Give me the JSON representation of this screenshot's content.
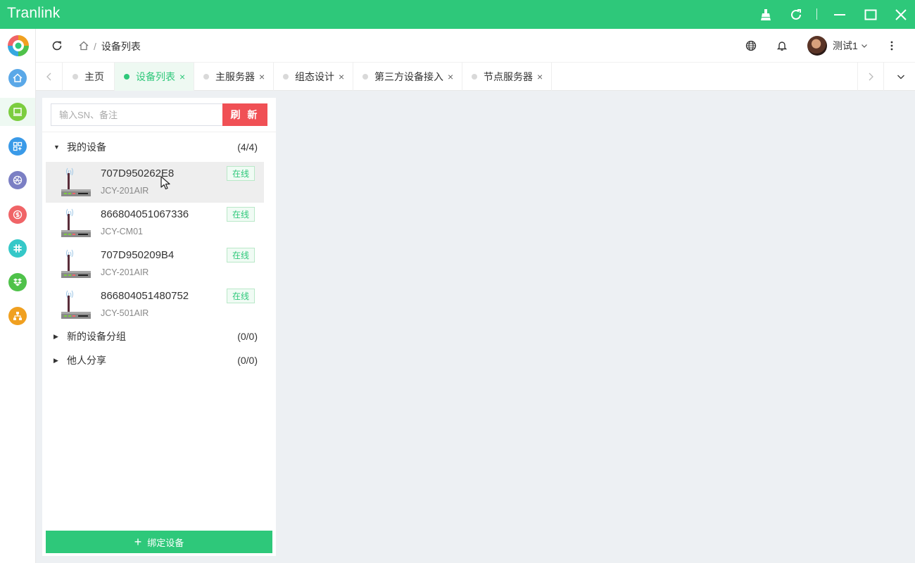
{
  "window": {
    "title": "Tranlink",
    "controls": [
      "broom-icon",
      "refresh-icon",
      "minimize-icon",
      "maximize-icon",
      "close-icon"
    ]
  },
  "colors": {
    "primary": "#2ec87a",
    "danger": "#f05055",
    "content_bg": "#edf0f3"
  },
  "sidebar": {
    "items": [
      {
        "name": "home",
        "icon": "home-icon",
        "color": "#5aa8e8"
      },
      {
        "name": "device",
        "icon": "monitor-icon",
        "color": "#7ccd3f",
        "active": true
      },
      {
        "name": "apps",
        "icon": "apps-icon",
        "color": "#3a9ae8"
      },
      {
        "name": "dribbble",
        "icon": "dribbble-icon",
        "color": "#7b7fc4"
      },
      {
        "name": "money",
        "icon": "money-icon",
        "color": "#f06467"
      },
      {
        "name": "slack",
        "icon": "slack-icon",
        "color": "#35c8c8"
      },
      {
        "name": "dropbox",
        "icon": "dropbox-icon",
        "color": "#4fc24a"
      },
      {
        "name": "org",
        "icon": "sitemap-icon",
        "color": "#f0a020"
      }
    ]
  },
  "header": {
    "breadcrumb": {
      "current": "设备列表",
      "separator": "/"
    },
    "user": {
      "name": "测试1"
    }
  },
  "tabs": [
    {
      "label": "主页",
      "closable": false,
      "active": false
    },
    {
      "label": "设备列表",
      "closable": true,
      "active": true
    },
    {
      "label": "主服务器",
      "closable": true,
      "active": false
    },
    {
      "label": "组态设计",
      "closable": true,
      "active": false
    },
    {
      "label": "第三方设备接入",
      "closable": true,
      "active": false
    },
    {
      "label": "节点服务器",
      "closable": true,
      "active": false
    }
  ],
  "tab_close_glyph": "×",
  "device_panel": {
    "search": {
      "placeholder": "输入SN、备注",
      "value": ""
    },
    "refresh_label": "刷 新",
    "groups": [
      {
        "name": "我的设备",
        "count": "(4/4)",
        "expanded": true
      },
      {
        "name": "新的设备分组",
        "count": "(0/0)",
        "expanded": false
      },
      {
        "name": "他人分享",
        "count": "(0/0)",
        "expanded": false
      }
    ],
    "devices": [
      {
        "sn": "707D950262E8",
        "model": "JCY-201AIR",
        "status": "在线"
      },
      {
        "sn": "866804051067336",
        "model": "JCY-CM01",
        "status": "在线"
      },
      {
        "sn": "707D950209B4",
        "model": "JCY-201AIR",
        "status": "在线"
      },
      {
        "sn": "866804051480752",
        "model": "JCY-501AIR",
        "status": "在线"
      }
    ],
    "bind_label": "绑定设备"
  }
}
